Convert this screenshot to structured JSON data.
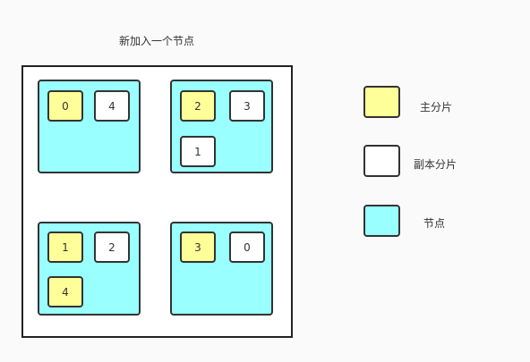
{
  "title": "新加入一个节点",
  "nodes": [
    {
      "primaries": [
        "0"
      ],
      "replicas": [
        "4"
      ]
    },
    {
      "primaries": [
        "2"
      ],
      "replicas": [
        "3",
        "1"
      ]
    },
    {
      "primaries": [
        "1",
        "4"
      ],
      "replicas": [
        "2"
      ]
    },
    {
      "primaries": [
        "3"
      ],
      "replicas": [
        "0"
      ]
    }
  ],
  "legend": {
    "primary_label": "主分片",
    "replica_label": "副本分片",
    "node_label": "节点"
  },
  "colors": {
    "primary": "#ffff99",
    "replica": "#ffffff",
    "node": "#99ffff"
  }
}
